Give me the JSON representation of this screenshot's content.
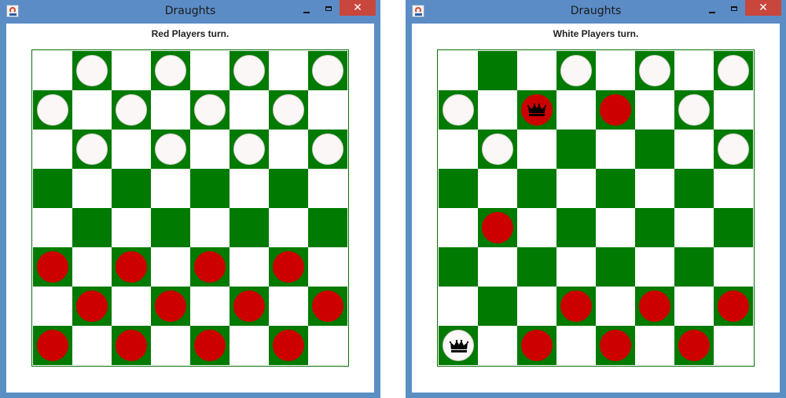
{
  "colors": {
    "board_dark": "#007a00",
    "board_light": "#ffffff",
    "piece_white": "#fbf7f6",
    "piece_red": "#cc0000",
    "titlebar": "#5b8cc6",
    "close_button": "#c9463d"
  },
  "icons": {
    "app": "java-icon",
    "minimize": "minimize-icon",
    "maximize": "maximize-icon",
    "close": "close-icon",
    "king": "crown-icon"
  },
  "windows": [
    {
      "title": "Draughts",
      "close_label": "✕",
      "status": "Red Players turn.",
      "board": [
        [
          "",
          "w",
          "",
          "w",
          "",
          "w",
          "",
          "w"
        ],
        [
          "w",
          "",
          "w",
          "",
          "w",
          "",
          "w",
          ""
        ],
        [
          "",
          "w",
          "",
          "w",
          "",
          "w",
          "",
          "w"
        ],
        [
          "",
          "",
          "",
          "",
          "",
          "",
          "",
          ""
        ],
        [
          "",
          "",
          "",
          "",
          "",
          "",
          "",
          ""
        ],
        [
          "r",
          "",
          "r",
          "",
          "r",
          "",
          "r",
          ""
        ],
        [
          "",
          "r",
          "",
          "r",
          "",
          "r",
          "",
          "r"
        ],
        [
          "r",
          "",
          "r",
          "",
          "r",
          "",
          "r",
          ""
        ]
      ]
    },
    {
      "title": "Draughts",
      "close_label": "✕",
      "status": "White Players turn.",
      "board": [
        [
          "",
          "",
          "",
          "w",
          "",
          "w",
          "",
          "w"
        ],
        [
          "w",
          "",
          "R",
          "",
          "r",
          "",
          "w",
          ""
        ],
        [
          "",
          "w",
          "",
          "",
          "",
          "",
          "",
          "w"
        ],
        [
          "",
          "",
          "",
          "",
          "",
          "",
          "",
          ""
        ],
        [
          "",
          "r",
          "",
          "",
          "",
          "",
          "",
          ""
        ],
        [
          "",
          "",
          "",
          "",
          "",
          "",
          "",
          ""
        ],
        [
          "",
          "",
          "",
          "r",
          "",
          "r",
          "",
          "r"
        ],
        [
          "W",
          "",
          "r",
          "",
          "r",
          "",
          "r",
          ""
        ]
      ]
    }
  ]
}
